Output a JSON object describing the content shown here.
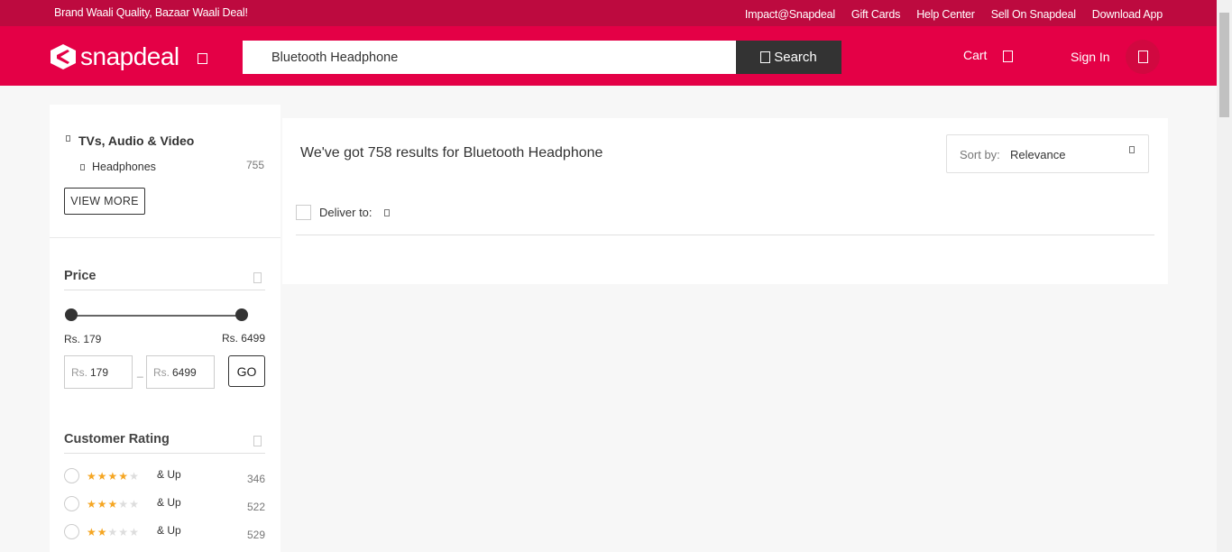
{
  "topstrip": {
    "tagline": "Brand Waali Quality, Bazaar Waali Deal!",
    "links": [
      "Impact@Snapdeal",
      "Gift Cards",
      "Help Center",
      "Sell On Snapdeal",
      "Download App"
    ]
  },
  "header": {
    "logo_text": "snapdeal",
    "search_value": "Bluetooth Headphone",
    "search_button": "Search",
    "cart_label": "Cart",
    "signin_label": "Sign In"
  },
  "sidebar": {
    "category": {
      "title": "TVs, Audio & Video",
      "sub": [
        {
          "label": "Headphones",
          "count": "755"
        }
      ]
    },
    "view_more": "VIEW MORE",
    "price": {
      "title": "Price",
      "min_label": "Rs. 179",
      "max_label": "Rs. 6499",
      "currency": "Rs.",
      "min_value": "179",
      "max_value": "6499",
      "go": "GO",
      "slider_min_fraction": 0,
      "slider_max_fraction": 1
    },
    "rating": {
      "title": "Customer Rating",
      "and_up": "& Up",
      "rows": [
        {
          "stars": 4,
          "count": "346"
        },
        {
          "stars": 3,
          "count": "522"
        },
        {
          "stars": 2,
          "count": "529"
        }
      ]
    }
  },
  "main": {
    "results_text": "We've got 758 results for Bluetooth Headphone",
    "sort_label": "Sort by:",
    "sort_value": "Relevance",
    "deliver_label": "Deliver to:"
  },
  "colors": {
    "brand": "#e40046",
    "brand_dark": "#bd0a3f",
    "star": "#f5a623"
  }
}
